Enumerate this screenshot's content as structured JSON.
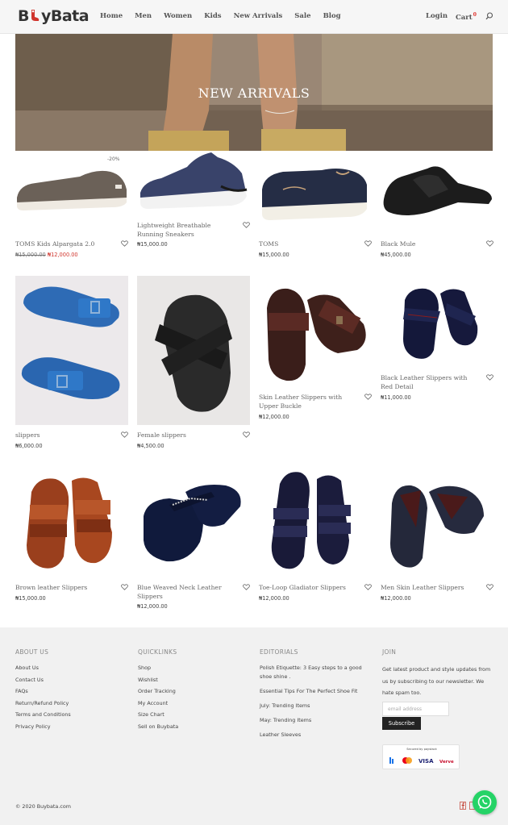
{
  "header": {
    "logo": "BuyBata",
    "nav": [
      "Home",
      "Men",
      "Women",
      "Kids",
      "New Arrivals",
      "Sale",
      "Blog"
    ],
    "login": "Login",
    "cart": "Cart",
    "cart_count": "0"
  },
  "hero": {
    "title": "NEW ARRIVALS"
  },
  "products": [
    {
      "name": "TOMS Kids Alpargata 2.0",
      "old_price": "₦15,000.00",
      "price": "₦12,000.00",
      "badge": "-20%"
    },
    {
      "name": "Lightweight Breathable Running Sneakers",
      "price": "₦15,000.00"
    },
    {
      "name": "TOMS",
      "price": "₦15,000.00"
    },
    {
      "name": "Black Mule",
      "price": "₦45,000.00"
    },
    {
      "name": "slippers",
      "price": "₦6,000.00"
    },
    {
      "name": "Female slippers",
      "price": "₦4,500.00"
    },
    {
      "name": "Skin Leather Slippers with Upper Buckle",
      "price": "₦12,000.00"
    },
    {
      "name": "Black Leather Slippers with Red Detail",
      "price": "₦11,000.00"
    },
    {
      "name": "Brown leather Slippers",
      "price": "₦15,000.00"
    },
    {
      "name": "Blue Weaved Neck Leather Slippers",
      "price": "₦12,000.00"
    },
    {
      "name": "Toe-Loop Gladiator Slippers",
      "price": "₦12,000.00"
    },
    {
      "name": "Men Skin Leather Slippers",
      "price": "₦12,000.00"
    }
  ],
  "footer": {
    "about": {
      "title": "ABOUT US",
      "links": [
        "About Us",
        "Contact Us",
        "FAQs",
        "Return/Refund Policy",
        "Terms and Conditions",
        "Privacy Policy"
      ]
    },
    "quicklinks": {
      "title": "QUICKLINKS",
      "links": [
        "Shop",
        "Wishlist",
        "Order Tracking",
        "My Account",
        "Size Chart",
        "Sell on Buybata"
      ]
    },
    "editorials": {
      "title": "EDITORIALS",
      "links": [
        "Polish Etiquette: 3 Easy steps to a good shoe shine .",
        "Essential Tips For The Perfect Shoe Fit",
        "July: Trending Items",
        "May: Trending Items",
        "Leather Sleeves"
      ]
    },
    "join": {
      "title": "JOIN",
      "text": "Get latest product and style updates from us by subscribing to our newsletter. We hate spam too.",
      "email_placeholder": "email address",
      "subscribe": "Subscribe",
      "secured": "Secured by paystack",
      "cards": [
        "VISA",
        "Verve"
      ]
    },
    "copyright": "© 2020 Buybata.com"
  },
  "colors": {
    "accent": "#d0342c",
    "header_bg": "#f6f6f6",
    "footer_bg": "#f1f1f1",
    "whatsapp": "#25d366"
  }
}
